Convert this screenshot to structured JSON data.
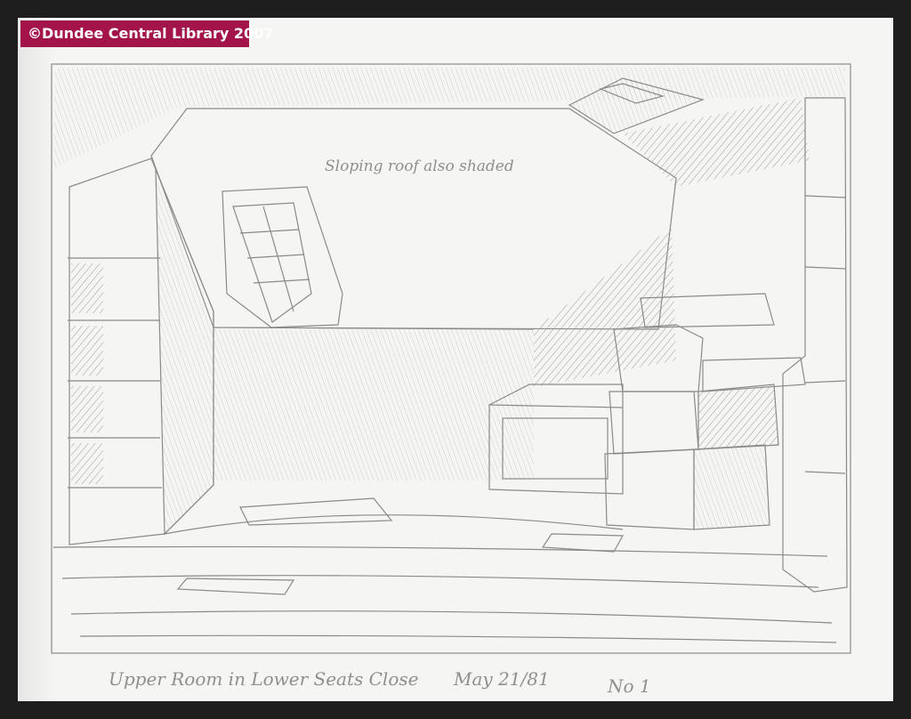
{
  "watermark": {
    "text": "©Dundee Central Library 2007",
    "color": "#a3154a"
  },
  "sketch": {
    "annotation": "Sloping roof also shaded",
    "caption": "Upper Room in Lower Seats Close",
    "date": "May 21/81",
    "number": "No 1"
  },
  "colors": {
    "background": "#1e1e1e",
    "paper": "#f5f5f3",
    "pencil": "#8a8a8a"
  }
}
